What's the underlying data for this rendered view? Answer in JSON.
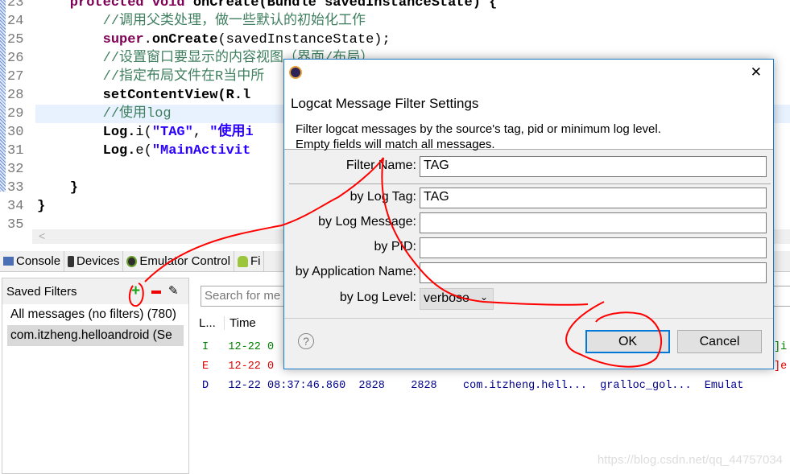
{
  "editor": {
    "lines": [
      {
        "n": "23",
        "parts": [
          [
            "kw",
            "    protected "
          ],
          [
            "kw",
            "void "
          ],
          [
            "bold",
            "onCreate(Bundle savedInstanceState) {"
          ]
        ]
      },
      {
        "n": "24",
        "parts": [
          [
            "cm",
            "        //调用父类处理，做一些默认的初始化工作"
          ]
        ]
      },
      {
        "n": "25",
        "parts": [
          [
            "kw",
            "        super"
          ],
          [
            "",
            "."
          ],
          [
            "bold",
            "onCreate"
          ],
          [
            "",
            "("
          ],
          [
            "",
            "savedInstanceState"
          ],
          [
            "",
            ");"
          ]
        ]
      },
      {
        "n": "26",
        "parts": [
          [
            "cm",
            "        //设置窗口要显示的内容视图（界面/布局）"
          ]
        ]
      },
      {
        "n": "27",
        "parts": [
          [
            "cm",
            "        //指定布局文件在R当中所"
          ]
        ]
      },
      {
        "n": "28",
        "parts": [
          [
            "bold",
            "        setContentView(R.l"
          ]
        ]
      },
      {
        "n": "29",
        "parts": [
          [
            "cm",
            "        //使用log"
          ]
        ]
      },
      {
        "n": "30",
        "parts": [
          [
            "bold",
            "        Log."
          ],
          [
            "",
            "i("
          ],
          [
            "st",
            "\"TAG\""
          ],
          [
            "",
            ", "
          ],
          [
            "st",
            "\"使用i"
          ]
        ]
      },
      {
        "n": "31",
        "parts": [
          [
            "bold",
            "        Log."
          ],
          [
            "",
            "e("
          ],
          [
            "st",
            "\"MainActivit"
          ]
        ]
      },
      {
        "n": "32",
        "parts": []
      },
      {
        "n": "33",
        "parts": [
          [
            "bold",
            "    }"
          ]
        ]
      },
      {
        "n": "34",
        "parts": [
          [
            "bold",
            "}"
          ]
        ]
      },
      {
        "n": "35",
        "parts": []
      }
    ],
    "scroll_left": "<"
  },
  "tabs": [
    {
      "label": "Console",
      "icon": "console-icon"
    },
    {
      "label": "Devices",
      "icon": "device-icon"
    },
    {
      "label": "Emulator Control",
      "icon": "emulator-icon"
    },
    {
      "label": "Fi",
      "icon": "android-icon"
    }
  ],
  "saved_filters": {
    "title": "Saved Filters",
    "items": [
      "All messages (no filters) (780)",
      "com.itzheng.helloandroid (Se"
    ]
  },
  "log": {
    "search_placeholder": "Search for me",
    "headers": [
      "L...",
      "Time"
    ],
    "rows": [
      {
        "text": "I   12-22 0",
        "color": "#008000",
        "tail": "]i",
        "tailcolor": "#008000"
      },
      {
        "text": "E   12-22 0",
        "color": "#e00000",
        "tail": "]e",
        "tailcolor": "#e00000"
      },
      {
        "text": "D   12-22 08:37:46.860  2828    2828    com.itzheng.hell...  gralloc_gol...  Emulat",
        "color": "#00008b"
      }
    ]
  },
  "dialog": {
    "title": "Logcat Message Filter Settings",
    "desc1": "Filter logcat messages by the source's tag, pid or minimum log level.",
    "desc2": "Empty fields will match all messages.",
    "fields": [
      {
        "label": "Filter Name:",
        "value": "TAG"
      },
      {
        "label": "by Log Tag:",
        "value": "TAG"
      },
      {
        "label": "by Log Message:",
        "value": ""
      },
      {
        "label": "by PID:",
        "value": ""
      },
      {
        "label": "by Application Name:",
        "value": ""
      }
    ],
    "log_level_label": "by Log Level:",
    "log_level": "verbose",
    "ok": "OK",
    "cancel": "Cancel",
    "close": "✕",
    "help": "?"
  },
  "watermark": "https://blog.csdn.net/qq_44757034",
  "colors": {
    "annotation": "#ff0000",
    "accent": "#0078d7"
  }
}
